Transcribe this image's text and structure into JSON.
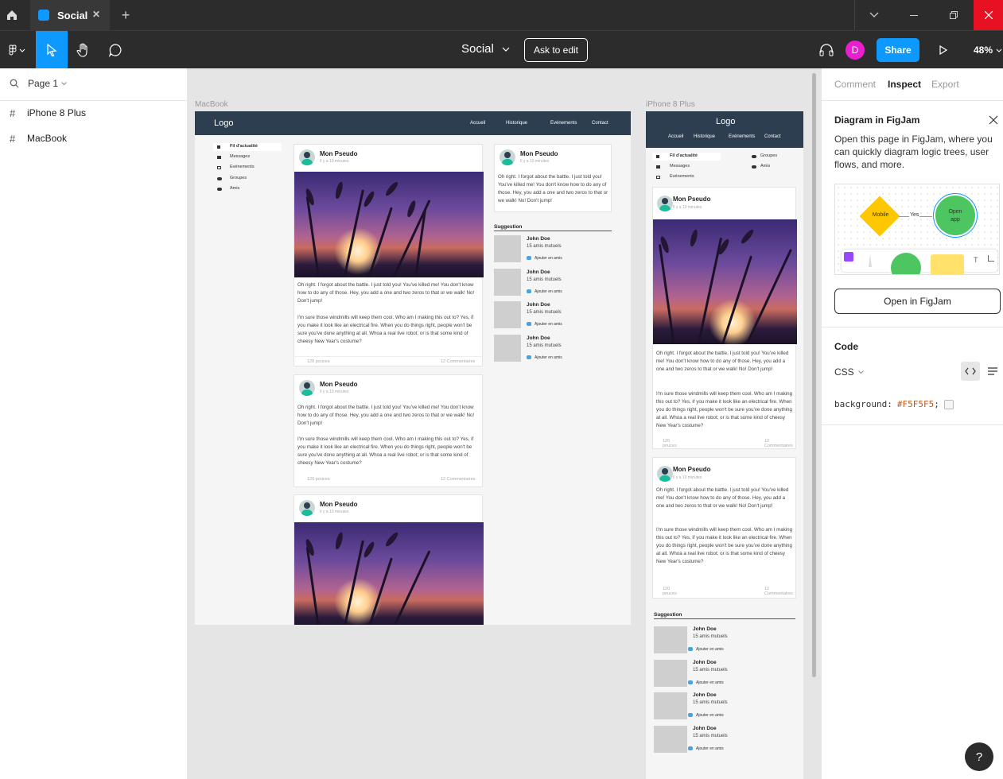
{
  "topbar": {
    "tab_title": "Social",
    "close_glyph": "✕",
    "new_tab_glyph": "+"
  },
  "toolbar": {
    "file_name": "Social",
    "ask_to_edit": "Ask to edit",
    "avatar_letter": "D",
    "share": "Share",
    "zoom": "48%"
  },
  "left": {
    "page_label": "Page 1",
    "frames": [
      {
        "label": "iPhone 8 Plus"
      },
      {
        "label": "MacBook"
      }
    ]
  },
  "right": {
    "tabs": [
      "Comment",
      "Inspect",
      "Export"
    ],
    "active_tab": "Inspect",
    "figjam": {
      "title": "Diagram in FigJam",
      "desc": "Open this page in FigJam, where you can quickly diagram logic trees, user flows, and more.",
      "mobile": "Mobile",
      "yes": "Yes",
      "open_app": "Open app",
      "button": "Open in FigJam"
    },
    "code": {
      "heading": "Code",
      "lang": "CSS",
      "prop": "background:",
      "value": "#F5F5F5",
      "semi": ";",
      "swatch": "#F5F5F5"
    },
    "help": "?"
  },
  "canvas": {
    "macbook_label": "MacBook",
    "iphone_label": "iPhone 8 Plus",
    "logo": "Logo",
    "nav": [
      "Accueil",
      "Historique",
      "Evénements",
      "Contact"
    ],
    "menu": [
      "Fil d'actualité",
      "Messages",
      "Evénements",
      "Groupes",
      "Amis"
    ],
    "pseudo": "Mon Pseudo",
    "time": "Il y a 10 minutes",
    "text1": "Oh right. I forgot about the battle. I just told you! You've killed me! You don't know how to do any of those. Hey, you add a one and two zeros to that or we walk! No! Don't jump!",
    "text2": "I'm sure those windmills will keep them cool. Who am I making this out to? Yes, if you make it look like an electrical fire. When you do things right, people won't be sure you've done anything at all. Whoa a real live robot; or is that some kind of cheesy New Year's costume?",
    "likes": "120 pouces",
    "comments": "12 Commentaires",
    "likes_m": "120 pouces",
    "comments_m": "12 Commentaires",
    "suggestion": "Suggestion",
    "sug_name": "John Doe",
    "sug_mutual": "15 amis mutuels",
    "sug_add": "Ajouter en amis"
  },
  "colors": {
    "frame_header": "#2c3e50",
    "share_blue": "#0d99ff",
    "avatar_pink": "#e91ecf",
    "close_red": "#e81123"
  }
}
